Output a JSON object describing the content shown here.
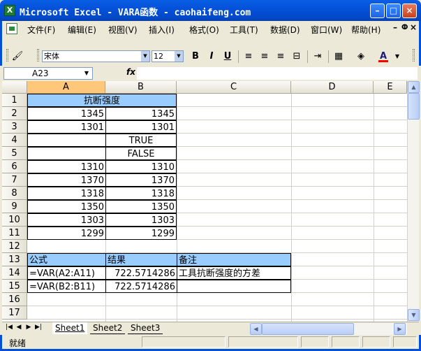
{
  "window": {
    "title": "Microsoft Excel - VARA函数 - caohaifeng.com",
    "app_icon": "excel-icon"
  },
  "menu": {
    "items": [
      "文件(F)",
      "编辑(E)",
      "视图(V)",
      "插入(I)",
      "格式(O)",
      "工具(T)",
      "数据(D)",
      "窗口(W)",
      "帮助(H)"
    ],
    "mdi_minimize": "–",
    "mdi_restore": "ⵀ",
    "mdi_close": "×"
  },
  "toolbar": {
    "font_name": "宋体",
    "font_size": "12",
    "bold": "B",
    "italic": "I",
    "underline": "U",
    "font_color": "#ff0000"
  },
  "formula_bar": {
    "name_box": "A23",
    "fx": "fx",
    "formula": ""
  },
  "columns": [
    "A",
    "B",
    "C",
    "D",
    "E"
  ],
  "rows": [
    "1",
    "2",
    "3",
    "4",
    "5",
    "6",
    "7",
    "8",
    "9",
    "10",
    "11",
    "12",
    "13",
    "14",
    "15",
    "16",
    "17"
  ],
  "cells": {
    "r1_ab": "抗断强度",
    "r2_a": "1345",
    "r2_b": "1345",
    "r3_a": "1301",
    "r3_b": "1301",
    "r4_b": "TRUE",
    "r5_b": "FALSE",
    "r6_a": "1310",
    "r6_b": "1310",
    "r7_a": "1370",
    "r7_b": "1370",
    "r8_a": "1318",
    "r8_b": "1318",
    "r9_a": "1350",
    "r9_b": "1350",
    "r10_a": "1303",
    "r10_b": "1303",
    "r11_a": "1299",
    "r11_b": "1299",
    "r13_a": "公式",
    "r13_b": "结果",
    "r13_c": "备注",
    "r14_a": "=VAR(A2:A11)",
    "r14_b": "722.5714286",
    "r14_c": "工具抗断强度的方差",
    "r15_a": "=VAR(B2:B11)",
    "r15_b": "722.5714286"
  },
  "sheets": [
    "Sheet1",
    "Sheet2",
    "Sheet3"
  ],
  "active_sheet": "Sheet1",
  "status": {
    "text": "就绪"
  }
}
